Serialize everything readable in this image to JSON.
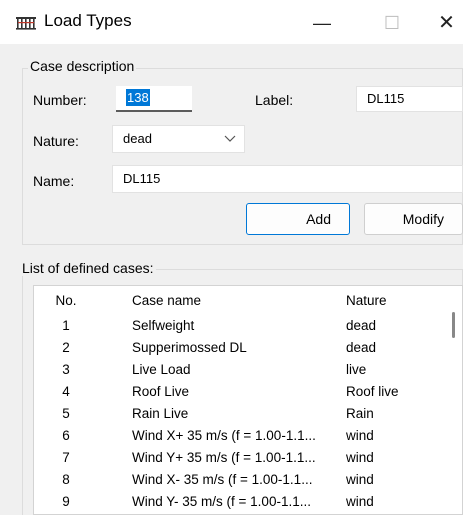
{
  "window": {
    "title": "Load Types",
    "minimize": "—",
    "maximize": "☐",
    "close": "✕"
  },
  "case_description": {
    "group_label": "Case description",
    "number_label": "Number:",
    "number_value": "138",
    "label_label": "Label:",
    "label_value": "DL115",
    "nature_label": "Nature:",
    "nature_value": "dead",
    "name_label": "Name:",
    "name_value": "DL115",
    "add_button": "Add",
    "modify_button": "Modify"
  },
  "defined_cases": {
    "group_label": "List of defined cases:",
    "columns": [
      "No.",
      "Case name",
      "Nature"
    ],
    "rows": [
      {
        "no": "1",
        "name": "Selfweight",
        "nature": "dead"
      },
      {
        "no": "2",
        "name": "Supperimossed DL",
        "nature": "dead"
      },
      {
        "no": "3",
        "name": "Live Load",
        "nature": "live"
      },
      {
        "no": "4",
        "name": "Roof Live",
        "nature": "Roof live"
      },
      {
        "no": "5",
        "name": "Rain Live",
        "nature": "Rain"
      },
      {
        "no": "6",
        "name": "Wind X+ 35 m/s (f = 1.00-1.1...",
        "nature": "wind"
      },
      {
        "no": "7",
        "name": "Wind Y+ 35 m/s (f = 1.00-1.1...",
        "nature": "wind"
      },
      {
        "no": "8",
        "name": "Wind X- 35 m/s (f = 1.00-1.1...",
        "nature": "wind"
      },
      {
        "no": "9",
        "name": "Wind Y- 35 m/s (f = 1.00-1.1...",
        "nature": "wind"
      }
    ]
  },
  "colors": {
    "accent": "#0078d7",
    "window_bg": "#f0f0f0"
  }
}
